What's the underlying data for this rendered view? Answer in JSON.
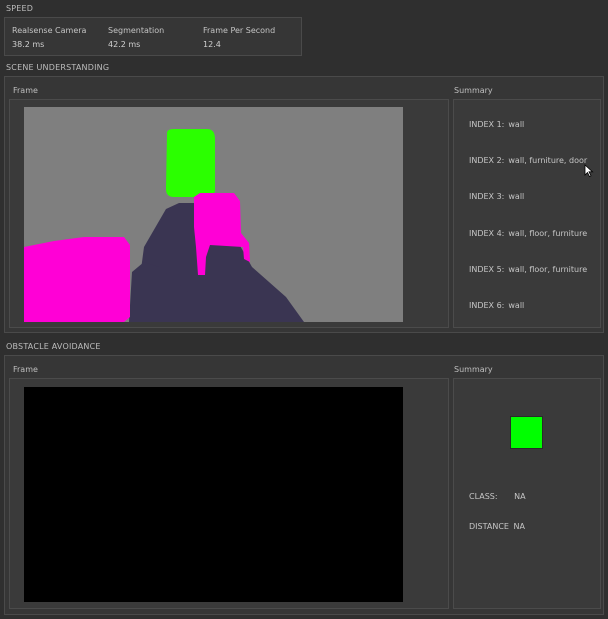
{
  "speed": {
    "title": "SPEED",
    "metrics": [
      {
        "label": "Realsense Camera",
        "value": "38.2 ms"
      },
      {
        "label": "Segmentation",
        "value": "42.2 ms"
      },
      {
        "label": "Frame Per Second",
        "value": "12.4"
      }
    ]
  },
  "scene": {
    "title": "SCENE UNDERSTANDING",
    "frame_label": "Frame",
    "summary_label": "Summary",
    "indices": [
      {
        "key": "INDEX 1:",
        "value": "wall"
      },
      {
        "key": "INDEX 2:",
        "value": "wall, furniture, door"
      },
      {
        "key": "INDEX 3:",
        "value": "wall"
      },
      {
        "key": "INDEX 4:",
        "value": "wall, floor, furniture"
      },
      {
        "key": "INDEX 5:",
        "value": "wall, floor, furniture"
      },
      {
        "key": "INDEX 6:",
        "value": "wall"
      }
    ],
    "colors": {
      "wall": "#7f7f7f",
      "furniture": "#ff00d6",
      "floor": "#3a3552",
      "door": "#2bff00"
    }
  },
  "obstacle": {
    "title": "OBSTACLE AVOIDANCE",
    "frame_label": "Frame",
    "summary_label": "Summary",
    "indicator_color": "#00ff00",
    "class_label": "CLASS:",
    "class_value": "NA",
    "distance_label": "DISTANCE",
    "distance_value": "NA"
  }
}
